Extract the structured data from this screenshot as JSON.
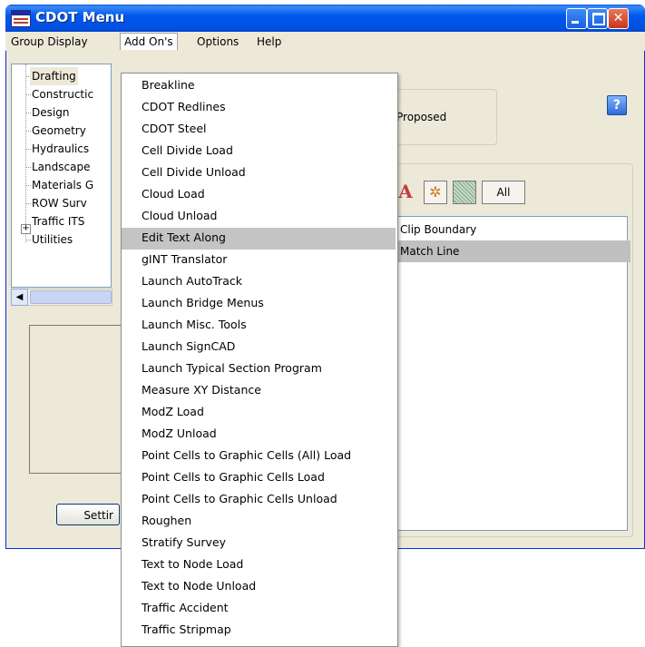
{
  "window": {
    "title": "CDOT Menu",
    "min_glyph": "",
    "max_glyph": "",
    "close_glyph": "✕"
  },
  "menubar": {
    "items": [
      "Group Display",
      "Add On's",
      "Options",
      "Help"
    ],
    "open_menu": "Add On's"
  },
  "tree": {
    "items": [
      "Drafting",
      "Constructic",
      "Design",
      "Geometry",
      "Hydraulics",
      "Landscape",
      "Materials G",
      "ROW Surv",
      "Traffic ITS",
      "Utilities"
    ],
    "selected": "Drafting",
    "expandable": "Traffic ITS",
    "expand_glyph": "+"
  },
  "scrollbar": {
    "left_glyph": "◀"
  },
  "settings_button": {
    "label": "Settir"
  },
  "proposed": {
    "label": "Proposed"
  },
  "help_button": {
    "label": "?"
  },
  "toolbar": {
    "text_glyph": "A",
    "star_glyph": "✲",
    "all_label": "All"
  },
  "list": {
    "items": [
      "Clip Boundary",
      "Match Line"
    ],
    "selected": "Match Line"
  },
  "dropdown": {
    "items": [
      "Breakline",
      "CDOT Redlines",
      "CDOT Steel",
      "Cell Divide Load",
      "Cell Divide Unload",
      "Cloud Load",
      "Cloud Unload",
      "Edit Text Along",
      "gINT Translator",
      "Launch AutoTrack",
      "Launch Bridge Menus",
      "Launch Misc. Tools",
      "Launch SignCAD",
      "Launch Typical Section Program",
      "Measure XY Distance",
      "ModZ Load",
      "ModZ Unload",
      "Point Cells to Graphic Cells (All) Load",
      "Point Cells to Graphic Cells Load",
      "Point Cells to Graphic Cells Unload",
      "Roughen",
      "Stratify Survey",
      "Text to Node Load",
      "Text to Node Unload",
      "Traffic Accident",
      "Traffic Stripmap"
    ],
    "highlighted": "Edit Text Along"
  },
  "colors": {
    "titlebar": "#0058ee",
    "window_bg": "#ece9d8",
    "highlight": "#c4c4c4",
    "close_button": "#c8351a"
  }
}
